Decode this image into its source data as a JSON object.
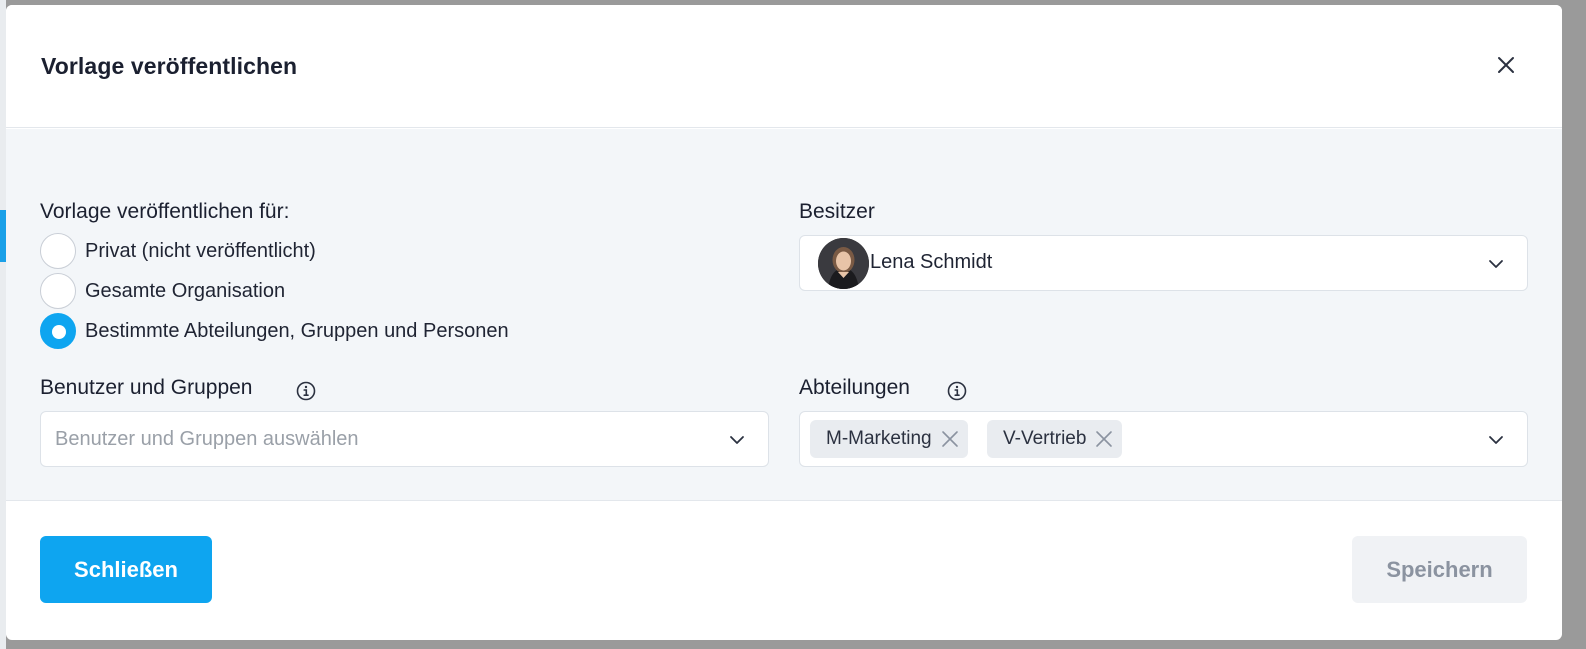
{
  "modal": {
    "title": "Vorlage veröffentlichen",
    "close_icon": "close-icon"
  },
  "publish_for": {
    "label": "Vorlage veröffentlichen für:",
    "options": [
      {
        "label": "Privat (nicht veröffentlicht)",
        "checked": false
      },
      {
        "label": "Gesamte Organisation",
        "checked": false
      },
      {
        "label": "Bestimmte Abteilungen, Gruppen und Personen",
        "checked": true
      }
    ]
  },
  "owner": {
    "label": "Besitzer",
    "name": "Lena Schmidt"
  },
  "users_groups": {
    "label": "Benutzer und Gruppen",
    "placeholder": "Benutzer und Gruppen auswählen"
  },
  "departments": {
    "label": "Abteilungen",
    "chips": [
      "M-Marketing",
      "V-Vertrieb"
    ]
  },
  "footer": {
    "close_label": "Schließen",
    "save_label": "Speichern"
  },
  "colors": {
    "accent": "#0ea5f0",
    "body_bg": "#f3f6f9",
    "secondary_btn_bg": "#f0f2f5"
  }
}
